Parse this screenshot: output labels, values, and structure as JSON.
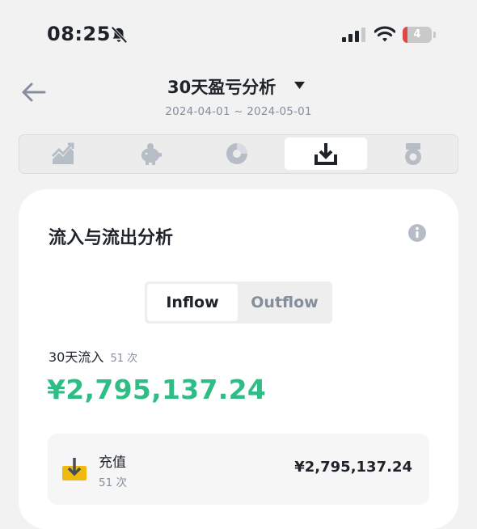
{
  "status_bar": {
    "time": "08:25",
    "battery_level": "4",
    "battery_color": "#e04646"
  },
  "header": {
    "title": "30天盈亏分析",
    "date_range": "2024-04-01 ~ 2024-05-01"
  },
  "tabs": [
    {
      "icon": "trend-chart-icon",
      "active": false
    },
    {
      "icon": "piggy-bank-icon",
      "active": false
    },
    {
      "icon": "pie-chart-icon",
      "active": false
    },
    {
      "icon": "inflow-download-icon",
      "active": true
    },
    {
      "icon": "medal-icon",
      "active": false
    }
  ],
  "card": {
    "title": "流入与流出分析",
    "segment": {
      "inflow_label": "Inflow",
      "outflow_label": "Outflow",
      "selected": "Inflow"
    },
    "summary": {
      "period_label": "30天流入",
      "count": "51 次",
      "amount": "¥2,795,137.24"
    },
    "rows": [
      {
        "icon": "deposit-icon",
        "label": "充值",
        "count": "51 次",
        "amount": "¥2,795,137.24"
      }
    ]
  },
  "colors": {
    "accent_green": "#2ebd85",
    "muted": "#848e9c",
    "text": "#1e2329",
    "deposit_yellow": "#f0b90b"
  }
}
